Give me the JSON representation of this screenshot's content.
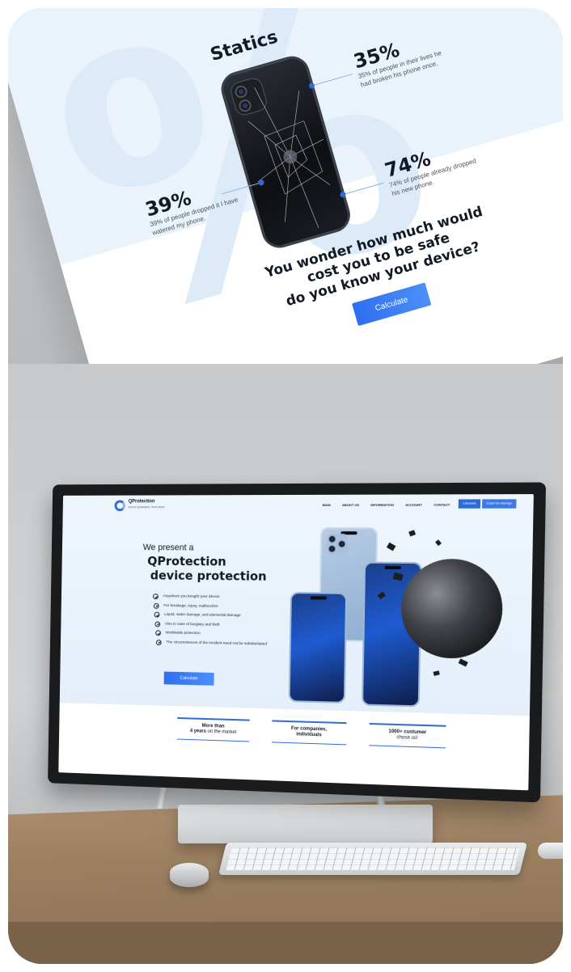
{
  "top_mockup": {
    "section_title": "Statics",
    "big_symbol": "%",
    "stats": [
      {
        "value": "35%",
        "text": "35% of people in their lives he had broken his phone once."
      },
      {
        "value": "39%",
        "text": "39% of people dropped it I have watered my phone."
      },
      {
        "value": "74%",
        "text": "74% of people already dropped his new phone."
      }
    ],
    "cta": {
      "heading_line1": "You wonder how much would",
      "heading_line2": "cost you to be safe",
      "heading_line3": "do you know your device?",
      "button_label": "Calculate"
    }
  },
  "screen_site": {
    "brand": {
      "name": "QProtection",
      "tagline": "Device protection, from future"
    },
    "nav": {
      "items": [
        "MAIN",
        "ABOUT US",
        "INFORMATION",
        "ACCOUNT",
        "CONTACT"
      ],
      "calculate_label": "Calculate",
      "claim_label": "Claim for damage"
    },
    "hero": {
      "intro": "We present a",
      "title_line1": "QProtection",
      "title_line2": "device protection",
      "features": [
        "Anywhere you bought your device",
        "For breakage, injury, malfunction",
        "Liquid, water damage, and elemental damage",
        "Also in case of burglary and theft",
        "Worldwide protection",
        "The circumstances of the incident need not be substantiated"
      ],
      "cta_label": "Calculate"
    },
    "band": [
      {
        "line1": "More than",
        "line2_bold": "4 years",
        "line2_rest": " on the market"
      },
      {
        "line1": "For companies,",
        "line2_bold": "individuals",
        "line2_rest": ""
      },
      {
        "line1": "1000+ custumer",
        "line2_bold": "",
        "line2_rest": "chose us!"
      }
    ]
  },
  "colors": {
    "accent": "#2f6bd8",
    "heading": "#121a26",
    "hero_bg": "#eef5fc",
    "wall": "#c7c9cb",
    "desk": "#9b7f61"
  },
  "icons": [
    "check-circle-icon",
    "logo-ring-icon"
  ]
}
